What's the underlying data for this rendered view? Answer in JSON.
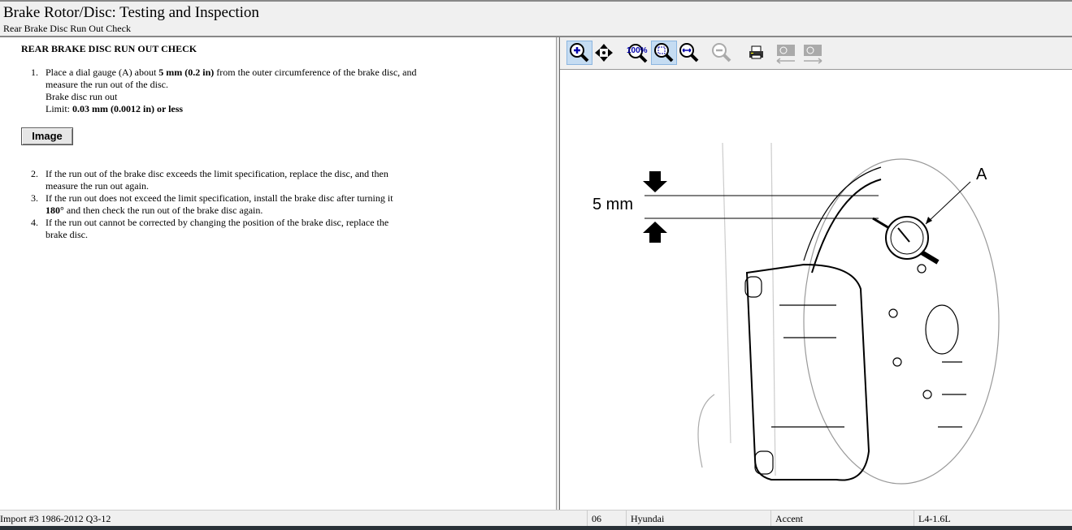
{
  "header": {
    "title": "Brake Rotor/Disc:  Testing and Inspection",
    "subtitle": "Rear Brake Disc Run Out Check"
  },
  "content": {
    "heading": "REAR BRAKE DISC RUN OUT CHECK",
    "steps": [
      {
        "num": "1.",
        "pre": "Place a dial gauge (A) about ",
        "bold": "5 mm (0.2 in)",
        "post": " from the outer circumference of the brake disc, and measure the run out of the disc.",
        "line2": "Brake disc run out",
        "limit_label": "Limit: ",
        "limit_value": "0.03 mm (0.0012 in) or less"
      },
      {
        "num": "2.",
        "text": "If the run out of the brake disc exceeds the limit specification, replace the disc, and then measure the run out again."
      },
      {
        "num": "3.",
        "pre": "If the run out does not exceed the limit specification, install the brake disc after turning it ",
        "bold": "180°",
        "post": " and then check the run out of the brake disc again."
      },
      {
        "num": "4.",
        "text": "If the run out cannot be corrected by changing the position of the brake disc, replace the brake disc."
      }
    ],
    "image_button": "Image"
  },
  "toolbar": {
    "zoom_pct": "100%"
  },
  "diagram": {
    "dimension_label": "5 mm",
    "callout": "A"
  },
  "status": {
    "database": "Import #3 1986-2012 Q3-12",
    "year": "06",
    "make": "Hyundai",
    "model": "Accent",
    "engine": "L4-1.6L"
  }
}
